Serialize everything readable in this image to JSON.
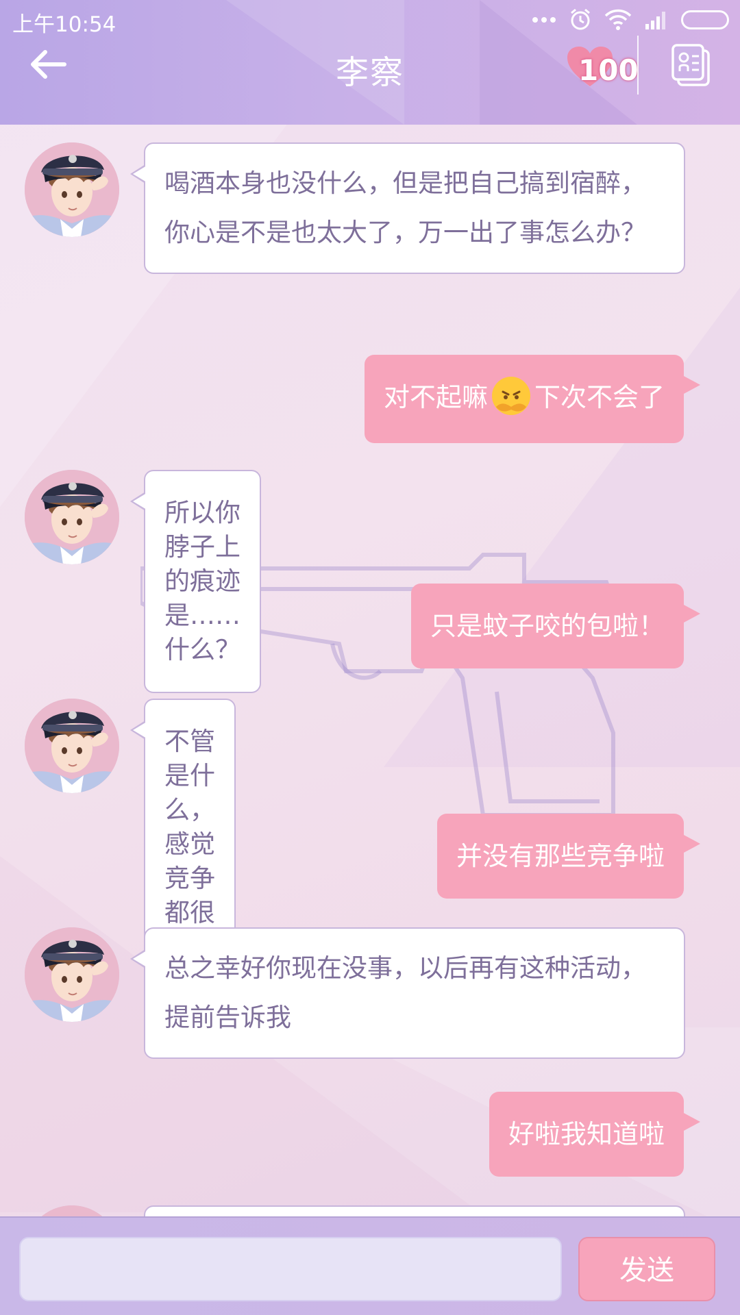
{
  "status_bar": {
    "time": "上午10:54"
  },
  "header": {
    "title": "李察",
    "affection": "100"
  },
  "messages": [
    {
      "side": "in",
      "text": "喝酒本身也没什么，但是把自己搞到宿醉，你心是不是也太大了，万一出了事怎么办？"
    },
    {
      "side": "out",
      "text_before": "对不起嘛",
      "emoji": "pouting-emoji",
      "text_after": "下次不会了"
    },
    {
      "side": "in",
      "text": "所以你脖子上的痕迹是……什么？"
    },
    {
      "side": "out",
      "text": "只是蚊子咬的包啦！"
    },
    {
      "side": "in",
      "text": "不管是什么，感觉竞争都很激烈"
    },
    {
      "side": "out",
      "text": "并没有那些竞争啦"
    },
    {
      "side": "in",
      "text": "总之幸好你现在没事，以后再有这种活动，提前告诉我"
    },
    {
      "side": "out",
      "text": "好啦我知道啦"
    }
  ],
  "input": {
    "value": "",
    "placeholder": ""
  },
  "send": {
    "label": "发送"
  },
  "colors": {
    "header": "#c7b0e8",
    "incoming_bubble": "#ffffff",
    "incoming_text": "#7e6f9a",
    "outgoing_bubble": "#f7a4bb",
    "outgoing_text": "#ffffff"
  }
}
